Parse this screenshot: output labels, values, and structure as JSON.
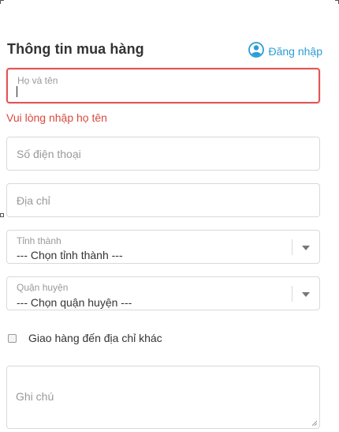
{
  "header": {
    "title": "Thông tin mua hàng",
    "login_label": "Đăng nhập",
    "login_icon": "user-circle-icon",
    "accent_color": "#2a9dd6"
  },
  "form": {
    "name": {
      "label": "Họ và tên",
      "value": "",
      "error": "Vui lòng nhập họ tên"
    },
    "phone": {
      "placeholder": "Số điện thoại"
    },
    "address": {
      "placeholder": "Địa chỉ"
    },
    "province": {
      "label": "Tỉnh thành",
      "selected": "--- Chọn tỉnh thành ---"
    },
    "district": {
      "label": "Quận huyện",
      "selected": "--- Chọn quận huyện ---"
    },
    "ship_other": {
      "label": "Giao hàng đến địa chỉ khác",
      "checked": false
    },
    "note": {
      "placeholder": "Ghi chú"
    },
    "error_color": "#e25555"
  }
}
